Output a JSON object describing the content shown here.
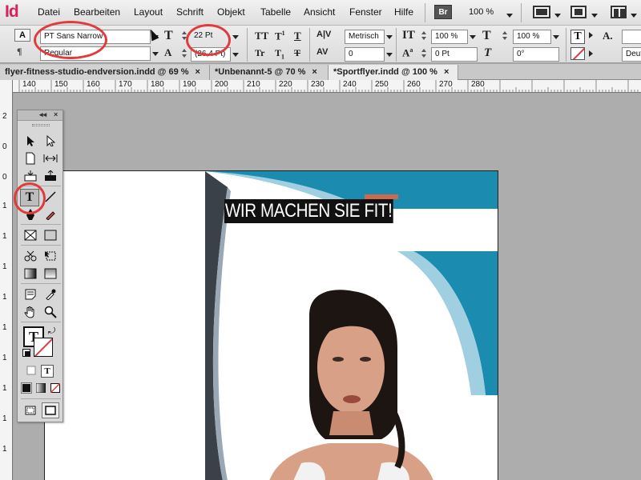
{
  "app": {
    "logo": "Id"
  },
  "menu": [
    "Datei",
    "Bearbeiten",
    "Layout",
    "Schrift",
    "Objekt",
    "Tabelle",
    "Ansicht",
    "Fenster",
    "Hilfe"
  ],
  "menubar_right": {
    "bridge": "Br",
    "zoom": "100 %"
  },
  "control_panel": {
    "font_family": "PT Sans Narrow",
    "font_style": "Regular",
    "font_size": "22 Pt",
    "leading": "(26,4 Pt)",
    "kerning": "Metrisch",
    "tracking": "0",
    "vertical_scale": "100 %",
    "baseline_shift": "0 Pt",
    "horizontal_scale": "100 %",
    "skew": "0°",
    "language": "Deutsc"
  },
  "tabs": [
    {
      "label": "flyer-fitness-studio-endversion.indd @ 69 %",
      "close": "×"
    },
    {
      "label": "*Unbenannt-5 @ 70 %",
      "close": "×"
    },
    {
      "label": "*Sportflyer.indd @ 100 %",
      "close": "×"
    }
  ],
  "ruler_h": [
    "140",
    "150",
    "160",
    "170",
    "180",
    "190",
    "200",
    "210",
    "220",
    "230",
    "240",
    "250",
    "260",
    "270",
    "280"
  ],
  "ruler_v": [
    "2",
    "0",
    "0",
    "1",
    "1",
    "1",
    "1",
    "1",
    "1",
    "1",
    "1",
    "1",
    "1"
  ],
  "document": {
    "headline": "WIR MACHEN SIE FIT!"
  },
  "colors": {
    "teal": "#1c8bb0",
    "light_blue": "#9fcfe0",
    "dark_gray": "#3b4149",
    "headline_bg": "#111111",
    "accent": "#c96b4f",
    "highlight_circle": "#e03c3c"
  },
  "tools": {
    "collapse": "◂◂",
    "close": "×",
    "items": [
      "selection-tool",
      "direct-selection-tool",
      "page-tool",
      "gap-tool",
      "content-collector-tool",
      "content-placer-tool",
      "type-tool",
      "line-tool",
      "pen-tool",
      "pencil-tool",
      "rectangle-frame-tool",
      "rectangle-tool",
      "scissors-tool",
      "free-transform-tool",
      "gradient-swatch-tool",
      "gradient-feather-tool",
      "note-tool",
      "eyedropper-tool",
      "hand-tool",
      "zoom-tool"
    ],
    "fill_stroke_label": "T"
  }
}
